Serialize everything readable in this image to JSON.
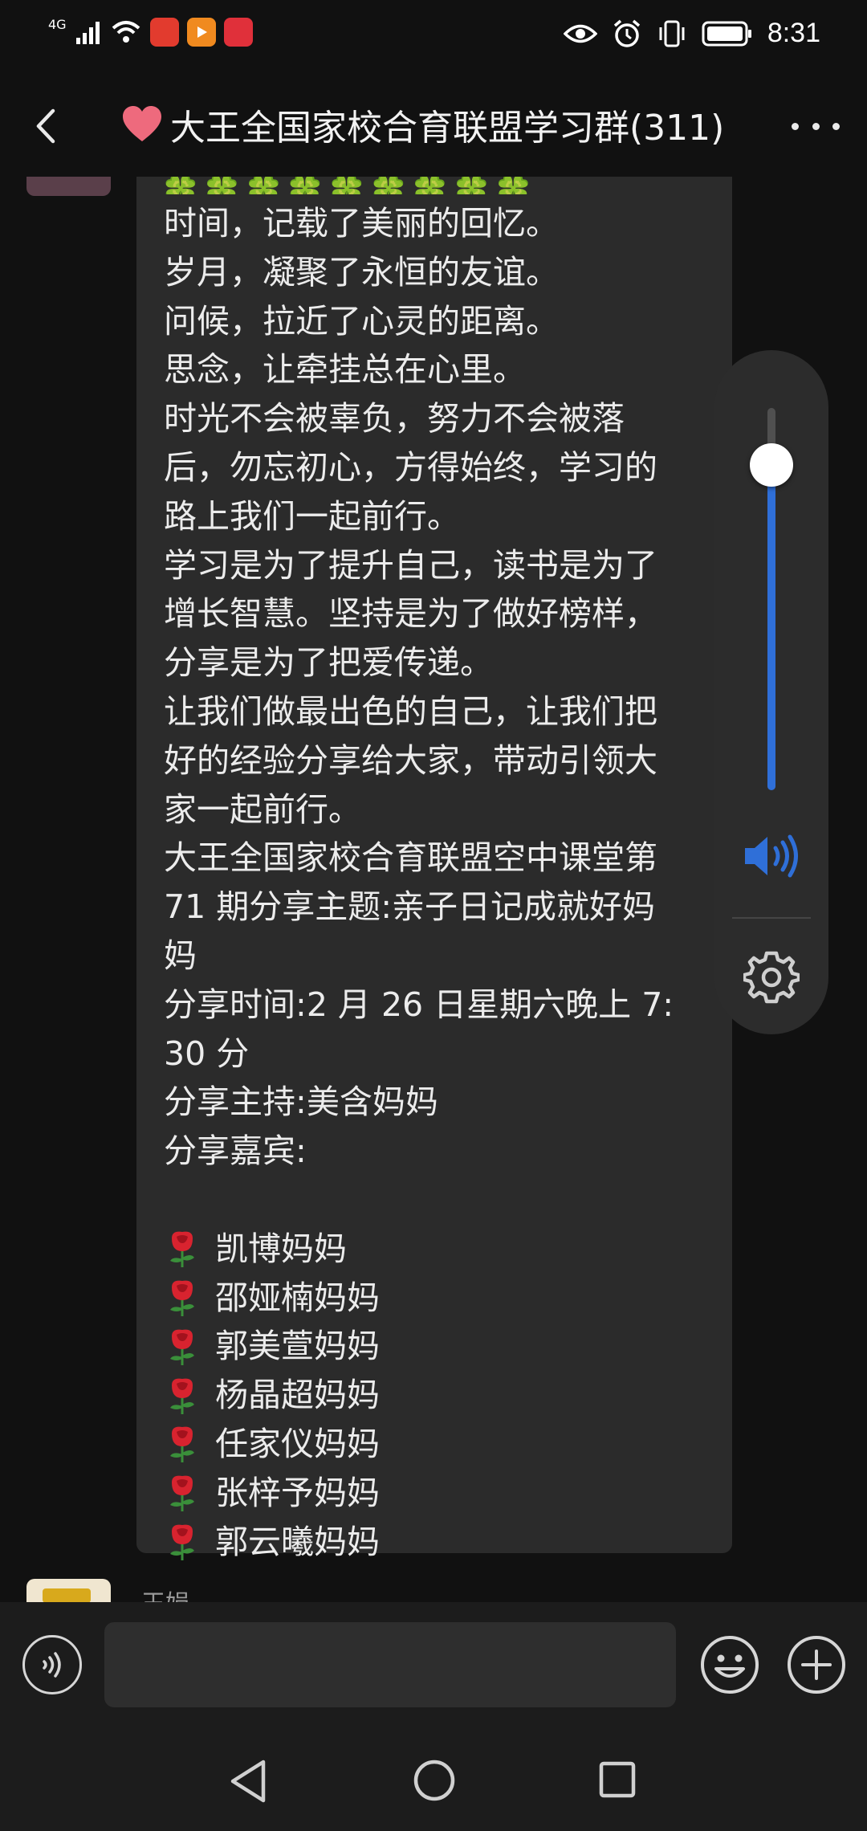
{
  "status_bar": {
    "network": "4G",
    "time": "8:31",
    "icons": [
      "signal-icon",
      "wifi-icon",
      "huawei-app-icon",
      "video-app-icon",
      "gift-app-icon",
      "eye-icon",
      "alarm-icon",
      "vibrate-icon",
      "battery-icon"
    ]
  },
  "header": {
    "title": "大王全国家校合育联盟学习群(311)",
    "title_icon": "heart-icon",
    "back_icon": "back-chevron-icon",
    "more_icon": "more-dots-icon"
  },
  "message": {
    "decoration": "🍀🍀🍀🍀🍀🍀🍀🍀🍀",
    "lines": [
      "时间，记载了美丽的回忆。",
      "岁月，凝聚了永恒的友谊。",
      "问候，拉近了心灵的距离。",
      "思念，让牵挂总在心里。",
      "时光不会被辜负，努力不会被落",
      "后，勿忘初心，方得始终，学习的",
      "路上我们一起前行。",
      "学习是为了提升自己，读书是为了",
      "增长智慧。坚持是为了做好榜样，",
      "分享是为了把爱传递。",
      "让我们做最出色的自己，让我们把",
      "好的经验分享给大家，带动引领大",
      "家一起前行。",
      "大王全国家校合育联盟空中课堂第",
      "71 期分享主题:亲子日记成就好妈",
      "妈",
      "分享时间:2 月 26 日星期六晚上 7:",
      "30 分",
      "分享主持:美含妈妈",
      "分享嘉宾:"
    ],
    "guests": [
      "凯博妈妈",
      "邵娅楠妈妈",
      "郭美萱妈妈",
      "杨晶超妈妈",
      "任家仪妈妈",
      "张梓予妈妈",
      "郭云曦妈妈"
    ]
  },
  "next_message": {
    "sender": "王娟"
  },
  "volume_panel": {
    "level": 0.85,
    "speaker_icon": "speaker-icon",
    "settings_icon": "gear-icon",
    "colors": {
      "fill": "#2f6fd8",
      "track": "#505050"
    }
  },
  "input_bar": {
    "value": "",
    "voice_icon": "voice-icon",
    "emoji_icon": "emoji-icon",
    "plus_icon": "plus-icon"
  },
  "nav_bar": {
    "back_icon": "nav-back-icon",
    "home_icon": "nav-home-icon",
    "recent_icon": "nav-recent-icon"
  }
}
